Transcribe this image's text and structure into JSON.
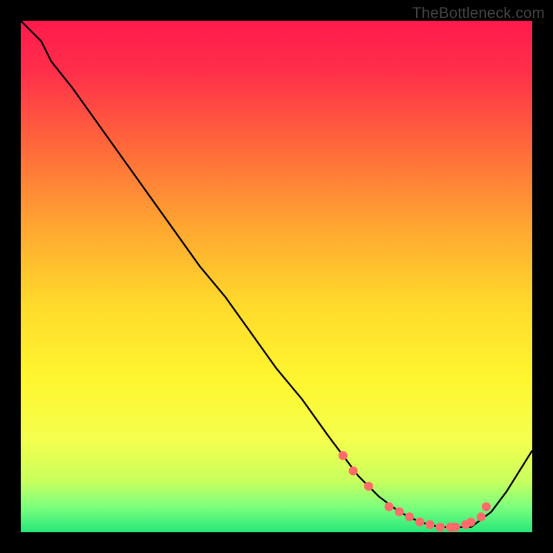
{
  "watermark": "TheBottleneck.com",
  "chart_data": {
    "type": "line",
    "title": "",
    "xlabel": "",
    "ylabel": "",
    "xlim": [
      0,
      100
    ],
    "ylim": [
      0,
      100
    ],
    "grid": false,
    "legend": false,
    "series": [
      {
        "name": "bottleneck-curve",
        "x": [
          0,
          4,
          6,
          10,
          15,
          20,
          25,
          30,
          35,
          40,
          45,
          50,
          55,
          60,
          63,
          66,
          70,
          74,
          78,
          82,
          85,
          88,
          92,
          95,
          100
        ],
        "y": [
          100,
          96,
          92,
          87,
          80,
          73,
          66,
          59,
          52,
          46,
          39,
          32,
          26,
          19,
          15,
          11,
          7,
          4,
          2,
          1,
          1,
          1,
          4,
          8,
          16
        ]
      }
    ],
    "markers": {
      "name": "highlight-points",
      "x": [
        63,
        65,
        68,
        72,
        74,
        76,
        78,
        80,
        82,
        84,
        85,
        87,
        88,
        90,
        91
      ],
      "y": [
        15,
        12,
        9,
        5,
        4,
        3,
        2,
        1.5,
        1,
        1,
        1,
        1.5,
        2,
        3,
        5
      ]
    },
    "gradient_stops": [
      {
        "offset": 0.0,
        "color": "#ff1a4d"
      },
      {
        "offset": 0.1,
        "color": "#ff2f4a"
      },
      {
        "offset": 0.25,
        "color": "#ff6a3a"
      },
      {
        "offset": 0.4,
        "color": "#ffa531"
      },
      {
        "offset": 0.55,
        "color": "#ffd92b"
      },
      {
        "offset": 0.7,
        "color": "#fff62f"
      },
      {
        "offset": 0.82,
        "color": "#f4ff4d"
      },
      {
        "offset": 0.9,
        "color": "#c8ff5e"
      },
      {
        "offset": 0.95,
        "color": "#7dff7d"
      },
      {
        "offset": 1.0,
        "color": "#26e87a"
      }
    ],
    "curve_color": "#000000",
    "marker_color": "#ff6b6b"
  }
}
